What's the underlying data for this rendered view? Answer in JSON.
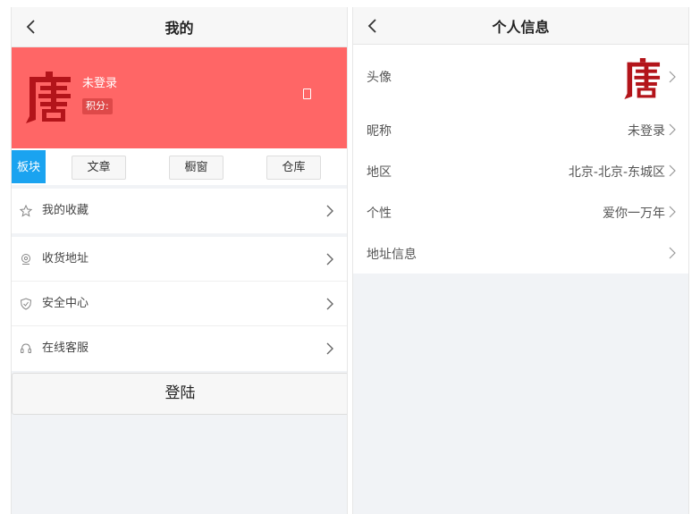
{
  "left_screen": {
    "title": "我的",
    "user": {
      "name": "未登录",
      "points_label": "积分:"
    },
    "tabs": [
      {
        "label": "板块",
        "active": true
      },
      {
        "label": "文章",
        "active": false
      },
      {
        "label": "橱窗",
        "active": false
      },
      {
        "label": "仓库",
        "active": false
      }
    ],
    "menu": [
      {
        "label": "我的收藏",
        "icon": "star-icon"
      },
      {
        "label": "收货地址",
        "icon": "location-icon"
      },
      {
        "label": "安全中心",
        "icon": "shield-icon"
      },
      {
        "label": "在线客服",
        "icon": "headset-icon"
      }
    ],
    "login_label": "登陆"
  },
  "right_screen": {
    "title": "个人信息",
    "rows": [
      {
        "label": "头像",
        "value": ""
      },
      {
        "label": "昵称",
        "value": "未登录"
      },
      {
        "label": "地区",
        "value": "北京-北京-东城区"
      },
      {
        "label": "个性",
        "value": "爱你一万年"
      },
      {
        "label": "地址信息",
        "value": ""
      }
    ]
  },
  "colors": {
    "accent_blue": "#1aa3f0",
    "hero_red": "#ff6666",
    "logo_red": "#b3141a"
  }
}
